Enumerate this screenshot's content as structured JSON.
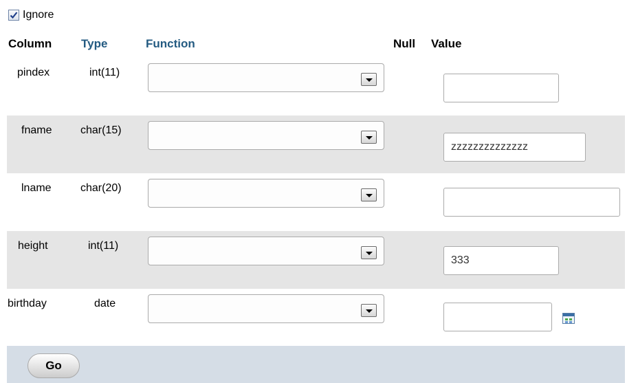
{
  "ignore": {
    "label": "Ignore",
    "checked": true
  },
  "header": {
    "column": "Column",
    "type": "Type",
    "function": "Function",
    "null": "Null",
    "value": "Value"
  },
  "rows": [
    {
      "column": "pindex",
      "type": "int(11)",
      "function": "",
      "value": ""
    },
    {
      "column": "fname",
      "type": "char(15)",
      "function": "",
      "value": "zzzzzzzzzzzzzz"
    },
    {
      "column": "lname",
      "type": "char(20)",
      "function": "",
      "value": ""
    },
    {
      "column": "height",
      "type": "int(11)",
      "function": "",
      "value": "333"
    },
    {
      "column": "birthday",
      "type": "date",
      "function": "",
      "value": "",
      "calendar_icon": "calendar-icon"
    }
  ],
  "footer": {
    "go_label": "Go"
  },
  "colors": {
    "link": "#235a81",
    "row_shade": "#e5e5e5",
    "footer_bg": "#d5dde6"
  }
}
